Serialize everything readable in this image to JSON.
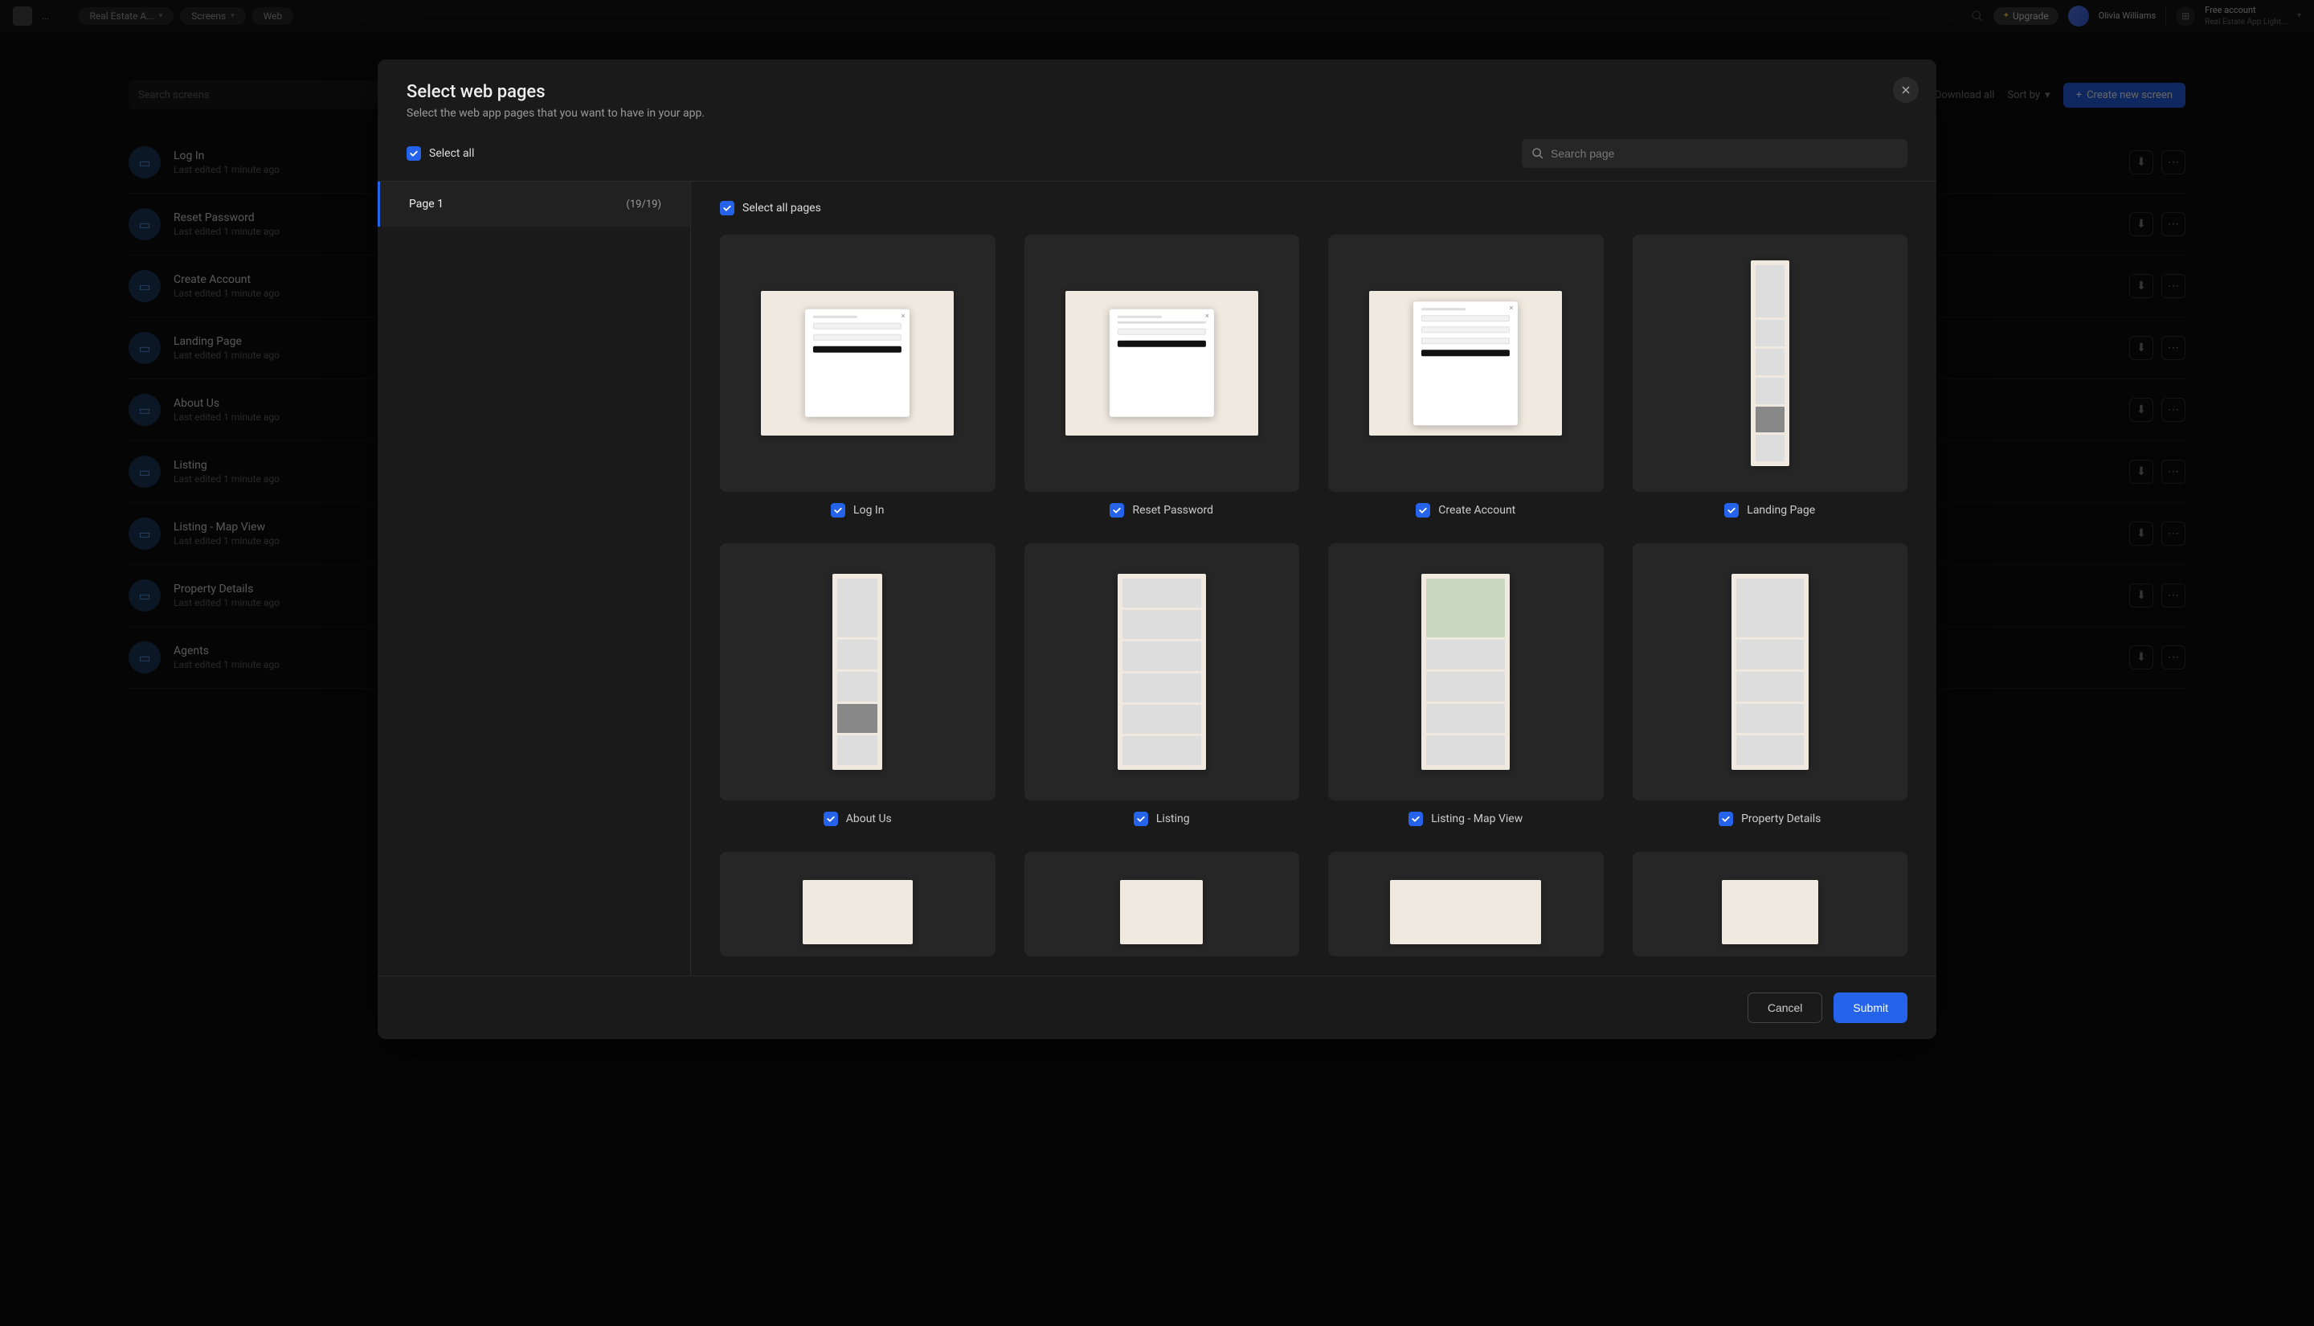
{
  "header": {
    "breadcrumb": "...",
    "pills": [
      "Real Estate A...",
      "Screens",
      "Web"
    ],
    "upgrade": "Upgrade",
    "user_name": "Olivia Williams",
    "user_email": "",
    "account_label": "Free account",
    "account_sub": "Real Estate App Light..."
  },
  "bg": {
    "search_placeholder": "Search screens",
    "link": "Download all",
    "filter": "Sort by",
    "primary": "Create new screen",
    "items": [
      {
        "title": "Log In",
        "sub": "Last edited 1 minute ago"
      },
      {
        "title": "Reset Password",
        "sub": "Last edited 1 minute ago"
      },
      {
        "title": "Create Account",
        "sub": "Last edited 1 minute ago"
      },
      {
        "title": "Landing Page",
        "sub": "Last edited 1 minute ago"
      },
      {
        "title": "About Us",
        "sub": "Last edited 1 minute ago"
      },
      {
        "title": "Listing",
        "sub": "Last edited 1 minute ago"
      },
      {
        "title": "Listing - Map View",
        "sub": "Last edited 1 minute ago"
      },
      {
        "title": "Property Details",
        "sub": "Last edited 1 minute ago"
      },
      {
        "title": "Agents",
        "sub": "Last edited 1 minute ago"
      }
    ]
  },
  "modal": {
    "title": "Select web pages",
    "subtitle": "Select the web app pages that you want to have in your app.",
    "select_all": "Select all",
    "search_placeholder": "Search page",
    "sidebar": {
      "page_label": "Page 1",
      "count": "(19/19)"
    },
    "select_all_pages": "Select all pages",
    "pages": [
      "Log In",
      "Reset Password",
      "Create Account",
      "Landing Page",
      "About Us",
      "Listing",
      "Listing - Map View",
      "Property Details"
    ],
    "cancel": "Cancel",
    "submit": "Submit"
  }
}
